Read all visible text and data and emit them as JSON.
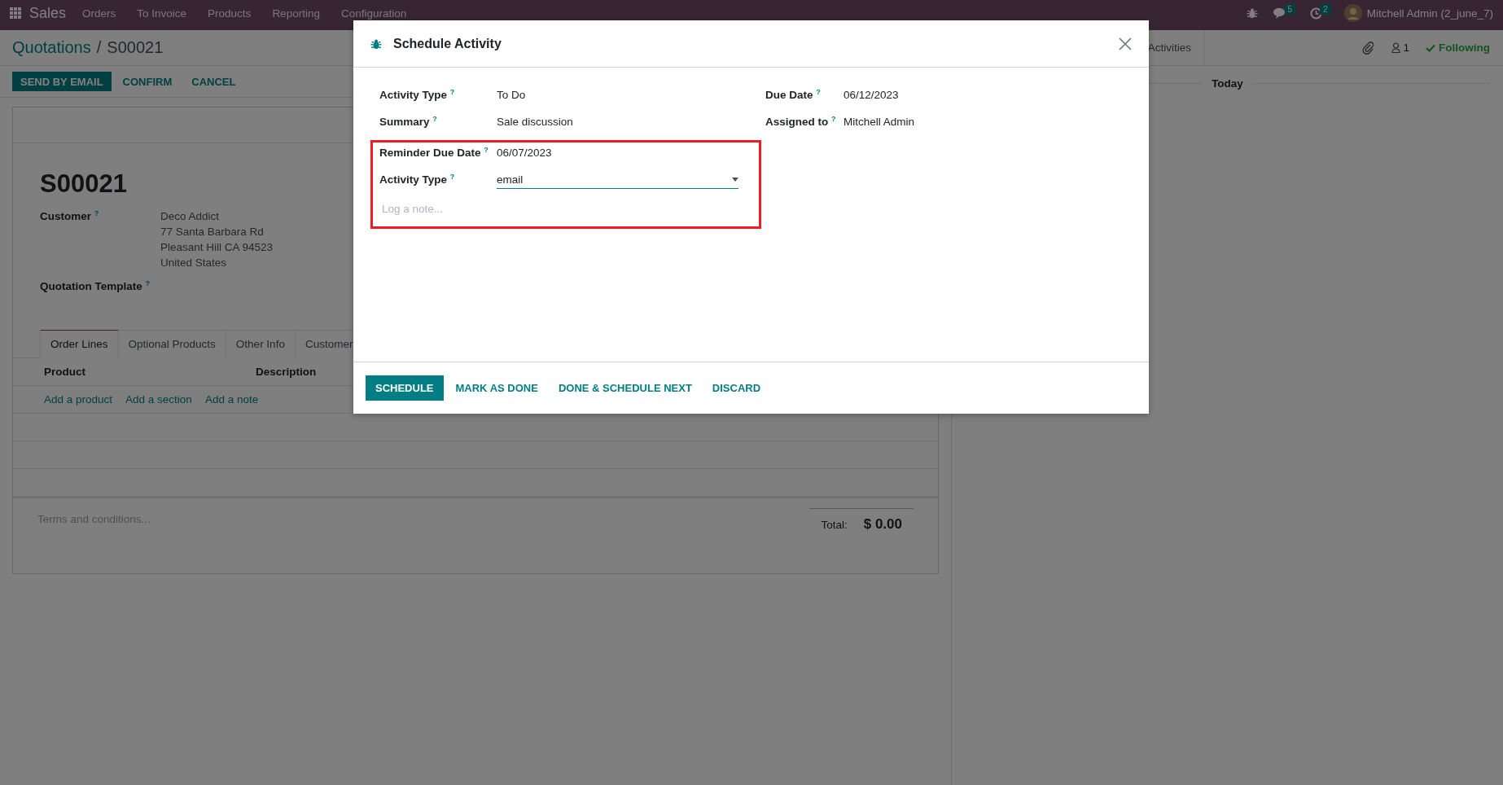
{
  "navbar": {
    "app": "Sales",
    "menus": [
      "Orders",
      "To Invoice",
      "Products",
      "Reporting",
      "Configuration"
    ],
    "messages_count": "5",
    "activities_count": "2",
    "user": "Mitchell Admin (2_june_7)"
  },
  "breadcrumb": {
    "parent": "Quotations",
    "separator": "/",
    "current": "S00021"
  },
  "actions": [
    {
      "label": "SEND BY EMAIL",
      "primary": true
    },
    {
      "label": "CONFIRM",
      "primary": false
    },
    {
      "label": "CANCEL",
      "primary": false
    }
  ],
  "form": {
    "name": "S00021",
    "fields": [
      {
        "label": "Customer $^{?}$",
        "lines": [
          "Deco Addict",
          "77 Santa Barbara Rd",
          "Pleasant Hill CA 94523",
          "United States"
        ]
      },
      {
        "label": "Quotation Template $^{?}$"
      }
    ],
    "tabs": [
      {
        "label": "Order Lines",
        "selected": true
      },
      {
        "label": "Optional Products",
        "selected": false
      },
      {
        "label": "Other Info",
        "selected": false
      },
      {
        "label": "Customer",
        "selected": false
      }
    ],
    "columns": [
      "Product",
      "Description"
    ],
    "add_links": [
      "Add a product",
      "Add a section",
      "Add a note"
    ],
    "terms_placeholder": "Terms and conditions...",
    "total_label": "Total:",
    "total": "$ 0.00"
  },
  "chatter": {
    "buttons": [
      "Activities"
    ],
    "followers_count": "1",
    "follow_label": "Following",
    "date_separator": "Today"
  },
  "dialog": {
    "title": "Schedule Activity",
    "left_fields": [
      {
        "label": "Activity Type $^{?}$",
        "value": "To Do",
        "kind": "text"
      },
      {
        "label": "Summary $^{?}$",
        "value": "Sale discussion",
        "kind": "text"
      }
    ],
    "right_fields": [
      {
        "label": "Due Date $^{?}$",
        "value": "06/12/2023",
        "kind": "text"
      },
      {
        "label": "Assigned to $^{?}$",
        "value": "Mitchell Admin",
        "kind": "text"
      }
    ],
    "highlight": {
      "color": "#ee1c25",
      "fields": [
        {
          "label": "Reminder Due Date $^{?}$",
          "value": "06/07/2023",
          "kind": "text"
        },
        {
          "label": "Activity Type $^{?}$",
          "value": "email",
          "kind": "select"
        }
      ],
      "note_placeholder": "Log a note..."
    },
    "buttons": [
      {
        "label": "SCHEDULE",
        "primary": true
      },
      {
        "label": "MARK AS DONE",
        "primary": false
      },
      {
        "label": "DONE & SCHEDULE NEXT",
        "primary": false
      },
      {
        "label": "DISCARD",
        "primary": false
      }
    ]
  }
}
